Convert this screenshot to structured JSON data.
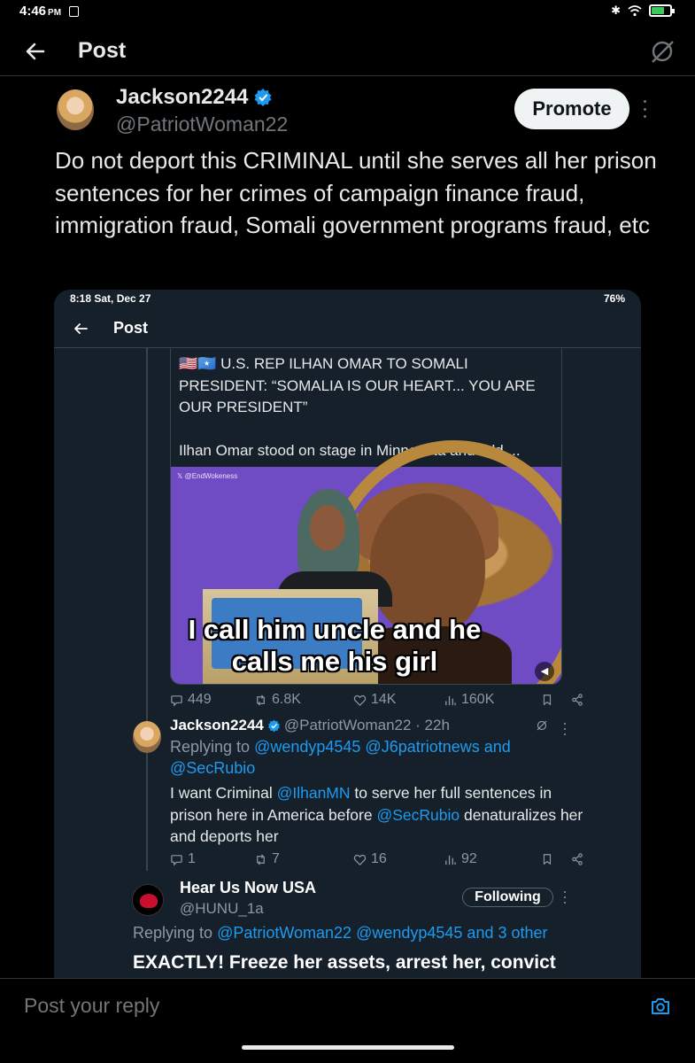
{
  "status_bar": {
    "time": "4:46",
    "ampm": "PM"
  },
  "header": {
    "title": "Post"
  },
  "post": {
    "author_name": "Jackson2244",
    "author_handle": "@PatriotWoman22",
    "promote_label": "Promote",
    "text": "Do not deport this CRIMINAL until she serves all her prison sentences for her crimes of campaign finance fraud, immigration fraud, Somali government programs fraud, etc"
  },
  "embed": {
    "status_left": "8:18  Sat, Dec 27",
    "status_right": "76%",
    "title": "Post",
    "quote": {
      "flags": "🇺🇸🇸🇴",
      "line": "U.S. REP ILHAN OMAR TO SOMALI PRESIDENT: “SOMALIA IS OUR HEART... YOU ARE OUR PRESIDENT”",
      "body": "Ilhan Omar stood on stage in Minnesota and told ...",
      "watermark": "𝕏 @EndWokeness",
      "caption": "I call him uncle and he calls me his girl"
    },
    "quote_actions": {
      "replies": "449",
      "reposts": "6.8K",
      "likes": "14K",
      "views": "160K"
    },
    "reply": {
      "name": "Jackson2244",
      "handle_time": "@PatriotWoman22 · 22h",
      "replying_prefix": "Replying to ",
      "replying_links": "@wendyp4545 @J6patriotnews and @SecRubio",
      "body_1": "I want Criminal ",
      "mention_1": "@IlhanMN",
      "body_2": " to serve her full sentences in prison here in America before ",
      "mention_2": "@SecRubio",
      "body_3": " denaturalizes her and deports her"
    },
    "reply_actions": {
      "replies": "1",
      "reposts": "7",
      "likes": "16",
      "views": "92"
    },
    "next": {
      "name": "Hear Us Now USA",
      "handle": "@HUNU_1a",
      "following_label": "Following",
      "replying_prefix": "Replying to ",
      "replying_links": "@PatriotWoman22 @wendyp4545 and 3 other",
      "text": "EXACTLY! Freeze her assets, arrest her, convict"
    }
  },
  "reply_bar": {
    "placeholder": "Post your reply"
  },
  "colors": {
    "accent": "#1d9bf0",
    "background": "#000000",
    "embed_bg": "#15202b"
  },
  "icons": [
    "back-arrow-icon",
    "grok-icon",
    "verified-badge-icon",
    "more-icon",
    "reply-icon",
    "repost-icon",
    "like-icon",
    "views-icon",
    "bookmark-icon",
    "share-icon",
    "camera-icon"
  ]
}
